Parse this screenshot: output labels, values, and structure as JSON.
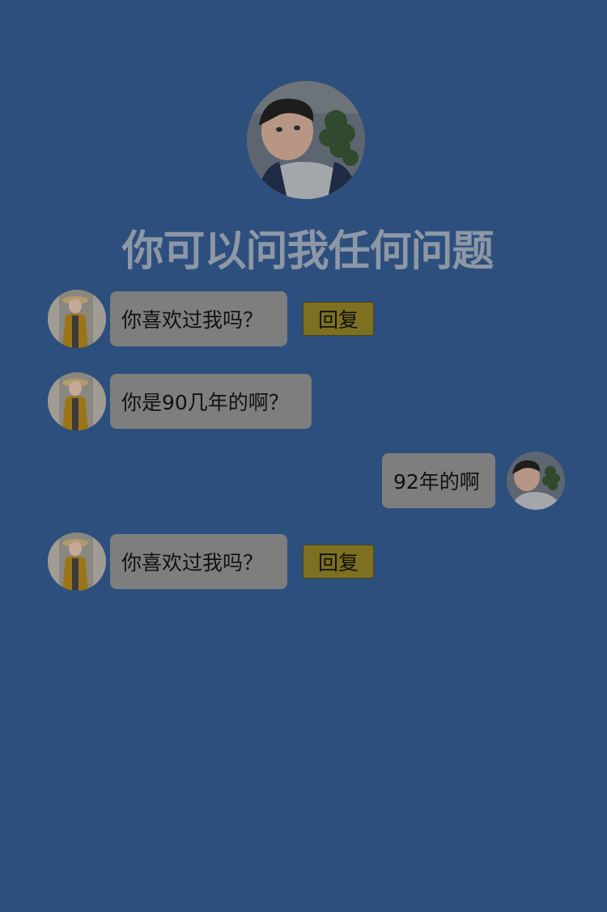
{
  "profile": {
    "avatar": "boy-photo-avatar"
  },
  "title": "你可以问我任何问题",
  "messages": [
    {
      "side": "left",
      "avatar": "girl-photo-avatar",
      "text": "你喜欢过我吗？",
      "reply_label": "回复"
    },
    {
      "side": "left",
      "avatar": "girl-photo-avatar",
      "text": "你是90几年的啊？"
    },
    {
      "side": "right",
      "avatar": "boy-photo-avatar",
      "text": "92年的啊"
    },
    {
      "side": "left",
      "avatar": "girl-photo-avatar",
      "text": "你喜欢过我吗？",
      "reply_label": "回复"
    }
  ],
  "colors": {
    "background": "#2d4f7d",
    "bubble": "#7e7e7e",
    "reply_button": "#7d7020",
    "title": "#8d97a6"
  }
}
